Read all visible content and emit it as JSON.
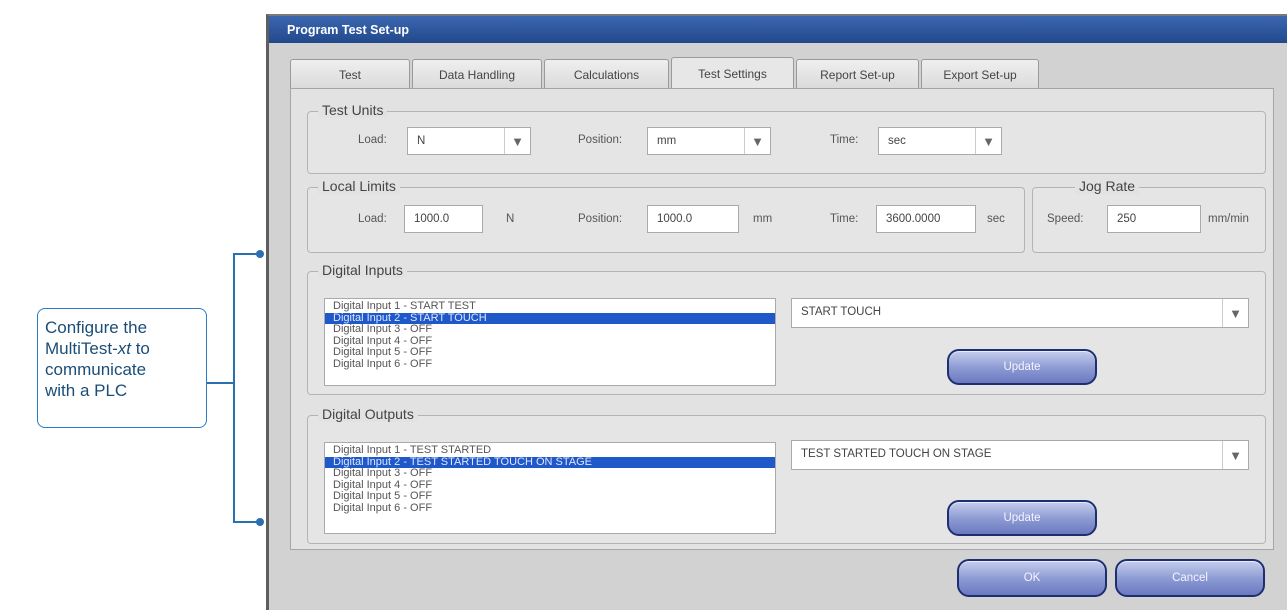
{
  "callout": {
    "line1": "Configure the",
    "line2_prefix": "MultiTest-",
    "line2_italic": "xt",
    "line2_suffix": " to",
    "line3": "communicate",
    "line4": "with a PLC"
  },
  "window": {
    "title": "Program Test Set-up"
  },
  "tabs": [
    {
      "label": "Test"
    },
    {
      "label": "Data Handling"
    },
    {
      "label": "Calculations"
    },
    {
      "label": "Test Settings"
    },
    {
      "label": "Report Set-up"
    },
    {
      "label": "Export Set-up"
    }
  ],
  "test_units": {
    "legend": "Test Units",
    "load_label": "Load:",
    "load_value": "N",
    "position_label": "Position:",
    "position_value": "mm",
    "time_label": "Time:",
    "time_value": "sec"
  },
  "local_limits": {
    "legend": "Local Limits",
    "load_label": "Load:",
    "load_value": "1000.0",
    "load_unit": "N",
    "position_label": "Position:",
    "position_value": "1000.0",
    "position_unit": "mm",
    "time_label": "Time:",
    "time_value": "3600.0000",
    "time_unit": "sec"
  },
  "jog_rate": {
    "legend": "Jog Rate",
    "speed_label": "Speed:",
    "speed_value": "250",
    "speed_unit": "mm/min"
  },
  "digital_inputs": {
    "legend": "Digital Inputs",
    "items": [
      "Digital Input 1 - START TEST",
      "Digital Input 2 - START TOUCH",
      "Digital Input 3 - OFF",
      "Digital Input 4 - OFF",
      "Digital Input 5 - OFF",
      "Digital Input 6 - OFF"
    ],
    "selected_value": "START TOUCH",
    "update_label": "Update"
  },
  "digital_outputs": {
    "legend": "Digital Outputs",
    "items": [
      "Digital Input 1 - TEST STARTED",
      "Digital Input 2 - TEST STARTED TOUCH ON STAGE",
      "Digital Input 3 - OFF",
      "Digital Input 4 - OFF",
      "Digital Input 5 - OFF",
      "Digital Input 6 - OFF"
    ],
    "selected_value": "TEST STARTED TOUCH ON STAGE",
    "update_label": "Update"
  },
  "footer": {
    "ok_label": "OK",
    "cancel_label": "Cancel"
  },
  "icons": {
    "dropdown_arrow": "▼"
  }
}
